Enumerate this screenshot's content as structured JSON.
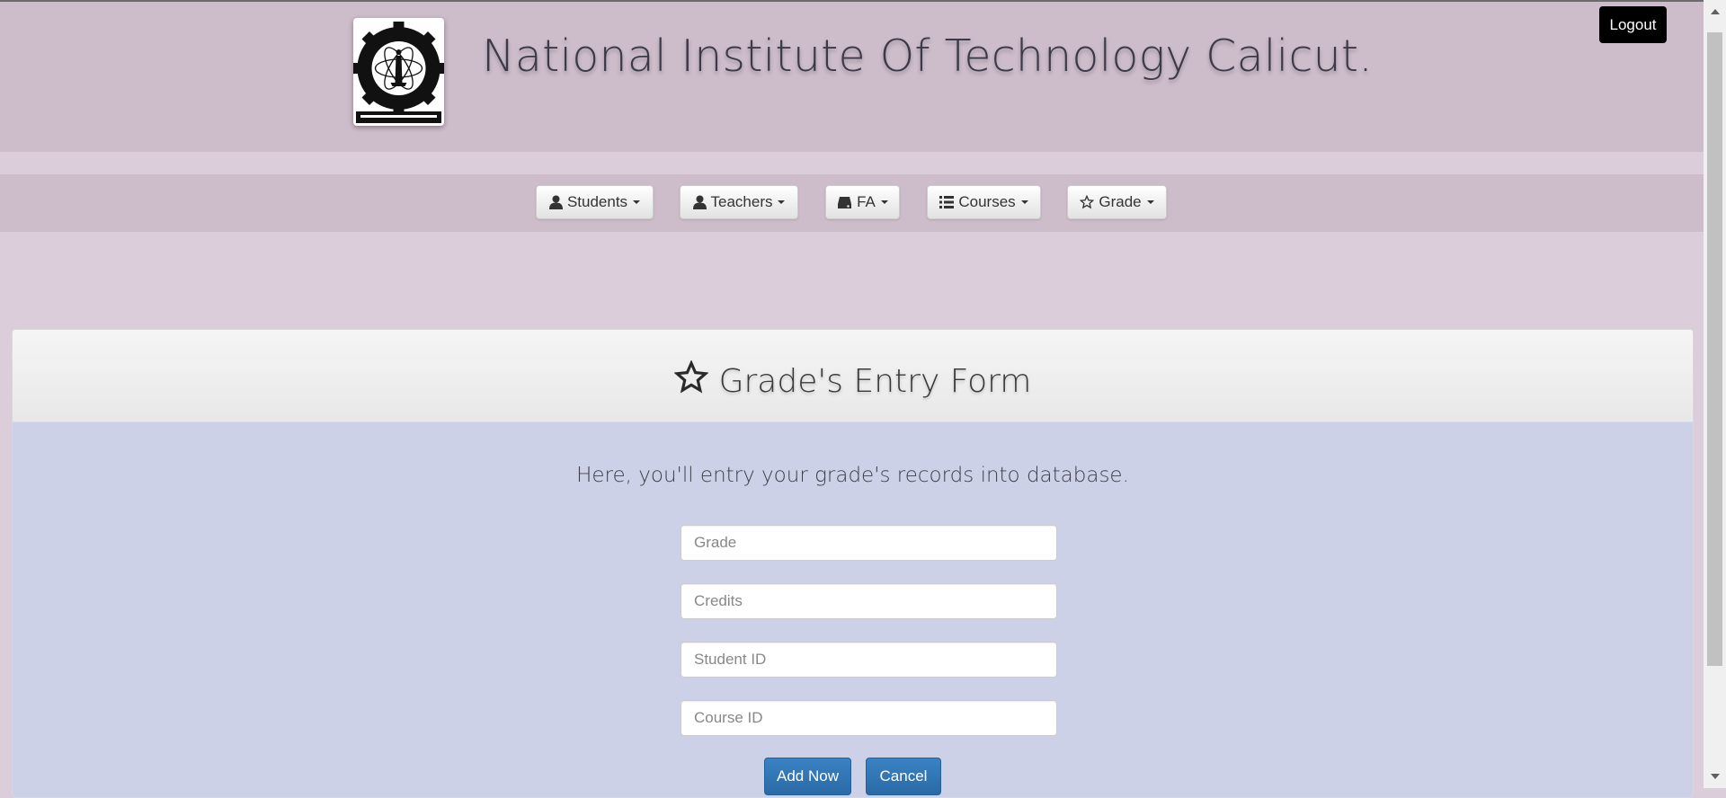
{
  "header": {
    "title": "National Institute Of Technology Calicut.",
    "logo_name": "nitc-logo",
    "logout_label": "Logout"
  },
  "nav": {
    "items": [
      {
        "label": "Students",
        "icon": "user-icon"
      },
      {
        "label": "Teachers",
        "icon": "user-icon"
      },
      {
        "label": "FA",
        "icon": "hdd-icon"
      },
      {
        "label": "Courses",
        "icon": "list-icon"
      },
      {
        "label": "Grade",
        "icon": "star-icon"
      }
    ]
  },
  "form": {
    "title": "Grade's Entry Form",
    "title_icon": "star-outline-icon",
    "subtitle": "Here, you'll entry your grade's records into database.",
    "fields": [
      {
        "placeholder": "Grade",
        "value": ""
      },
      {
        "placeholder": "Credits",
        "value": ""
      },
      {
        "placeholder": "Student ID",
        "value": ""
      },
      {
        "placeholder": "Course ID",
        "value": ""
      }
    ],
    "add_label": "Add Now",
    "cancel_label": "Cancel"
  },
  "colors": {
    "header_bg": "#cdbcca",
    "page_bg": "#dbcdd9",
    "panel_body_bg": "#cdd1e7",
    "primary": "#337ab7"
  }
}
